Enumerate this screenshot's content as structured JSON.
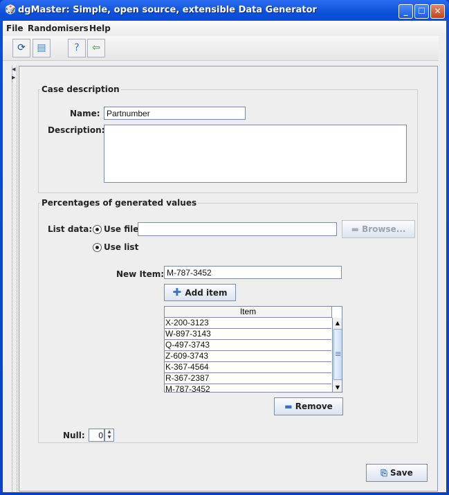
{
  "window": {
    "title": "dgMaster: Simple, open source, extensible Data Generator"
  },
  "menu": {
    "items": [
      "File",
      "Randomisers",
      "Help"
    ]
  },
  "case": {
    "legend": "Case description",
    "name_label": "Name:",
    "name_value": "Partnumber",
    "description_label": "Description:",
    "description_value": ""
  },
  "percentages": {
    "legend": "Percentages of generated values",
    "list_data_label": "List data:",
    "use_file_label": "Use file",
    "file_value": "",
    "browse_label": "Browse...",
    "use_list_label": "Use list",
    "selected_source": "Use list",
    "new_item_label": "New Item:",
    "new_item_value": "M-787-3452",
    "add_item_label": "Add item",
    "table_header": "Item",
    "items": [
      "X-200-3123",
      "W-897-3143",
      "Q-497-3743",
      "Z-609-3743",
      "K-367-4564",
      "R-367-2387",
      "M-787-3452"
    ],
    "remove_label": "Remove",
    "null_label": "Null:",
    "null_value": "0"
  },
  "save_label": "Save"
}
